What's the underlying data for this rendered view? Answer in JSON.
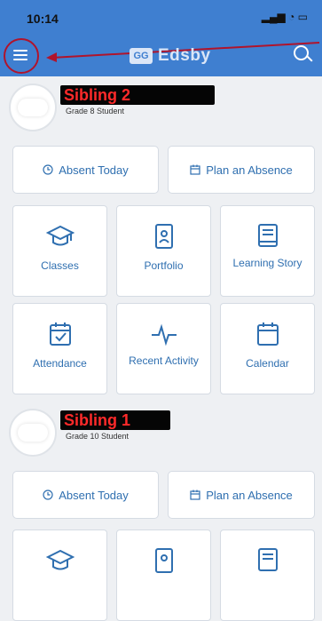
{
  "status_bar": {
    "time": "10:14"
  },
  "nav": {
    "brand_badge": "GG",
    "brand": "Edsby"
  },
  "siblings": [
    {
      "name": "Sibling 2",
      "grade": "Grade 8 Student",
      "absent_today": "Absent Today",
      "plan_absence": "Plan an Absence",
      "tiles": [
        {
          "label": "Classes",
          "icon": "mortarboard-icon"
        },
        {
          "label": "Portfolio",
          "icon": "portfolio-icon"
        },
        {
          "label": "Learning Story",
          "icon": "book-icon"
        },
        {
          "label": "Attendance",
          "icon": "calendar-check-icon"
        },
        {
          "label": "Recent Activity",
          "icon": "activity-icon"
        },
        {
          "label": "Calendar",
          "icon": "calendar-icon"
        }
      ]
    },
    {
      "name": "Sibling 1",
      "grade": "Grade 10 Student",
      "absent_today": "Absent Today",
      "plan_absence": "Plan an Absence"
    }
  ],
  "colors": {
    "accent": "#3f7fd0",
    "annotation_red": "#b0142c"
  }
}
